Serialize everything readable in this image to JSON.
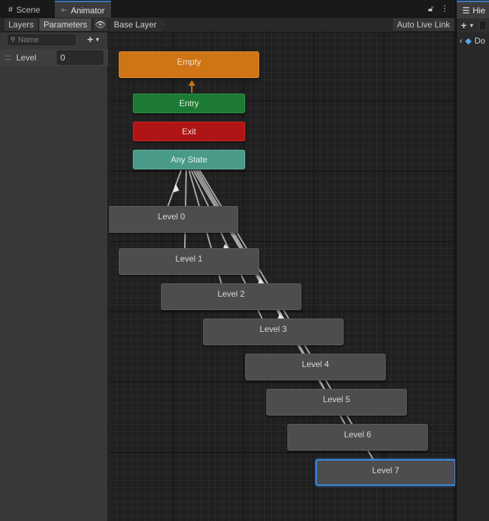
{
  "tabs": [
    {
      "label": "Scene",
      "icon": "grid-icon"
    },
    {
      "label": "Animator",
      "icon": "animator-icon",
      "active": true
    }
  ],
  "tab_tools": {
    "lock": "lock-icon",
    "menu": "kebab-menu-icon"
  },
  "toolbar": {
    "layers_label": "Layers",
    "parameters_label": "Parameters",
    "eye_icon": "eye-icon",
    "breadcrumb": "Base Layer",
    "auto_live_link_label": "Auto Live Link"
  },
  "parameters_panel": {
    "search_placeholder": "Name",
    "add_button": "+",
    "parameters": [
      {
        "name": "Level",
        "value": "0"
      }
    ]
  },
  "graph": {
    "nodes": {
      "empty": "Empty",
      "entry": "Entry",
      "exit": "Exit",
      "any_state": "Any State",
      "levels": [
        "Level 0",
        "Level 1",
        "Level 2",
        "Level 3",
        "Level 4",
        "Level 5",
        "Level 6",
        "Level 7"
      ]
    },
    "selected_node": "Level 7",
    "colors": {
      "empty": "#cf7516",
      "entry": "#1d7a34",
      "exit": "#b01515",
      "any_state": "#4a9a8a",
      "state": "#4d4d4f",
      "selection": "#3d8be0"
    }
  },
  "hierarchy_panel": {
    "tab_label": "Hie",
    "add_button": "+",
    "row_label": "Do"
  }
}
